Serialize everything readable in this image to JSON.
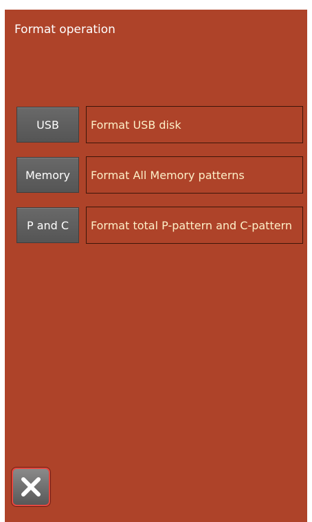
{
  "header": {
    "title": "Format operation"
  },
  "formats": [
    {
      "button_label": "USB",
      "description": "Format USB disk"
    },
    {
      "button_label": "Memory",
      "description": "Format All Memory patterns"
    },
    {
      "button_label": "P and C",
      "description": "Format total P-pattern and C-pattern"
    }
  ],
  "footer": {
    "close_icon": "close-x-icon"
  },
  "colors": {
    "background": "#ae4329",
    "button": "#5e5e5e",
    "description_text": "#fdf0c8",
    "close_border": "#e5473f"
  }
}
